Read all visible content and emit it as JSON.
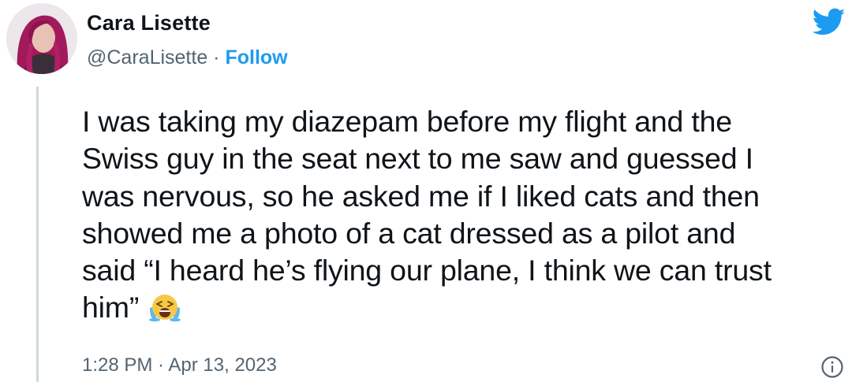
{
  "author": {
    "display_name": "Cara Lisette",
    "handle": "@CaraLisette",
    "separator": " · ",
    "follow_label": "Follow"
  },
  "tweet": {
    "lines": [
      "I was taking my diazepam before my flight and the",
      "Swiss guy in the seat next to me saw and guessed I",
      "was nervous, so he asked me if I liked cats and then",
      "showed me a photo of a cat dressed as a pilot and",
      "said “I heard he’s flying our plane, I think we can trust",
      "him”"
    ],
    "emoji": "loudly-crying-face"
  },
  "meta": {
    "time": "1:28 PM",
    "separator": " · ",
    "date": "Apr 13, 2023"
  },
  "icons": {
    "brand": "twitter-bird-icon",
    "info": "info-icon"
  },
  "colors": {
    "brand_blue": "#1d9bf0",
    "text_primary": "#0f1419",
    "text_secondary": "#536471",
    "thread_line": "#cfd9de"
  }
}
